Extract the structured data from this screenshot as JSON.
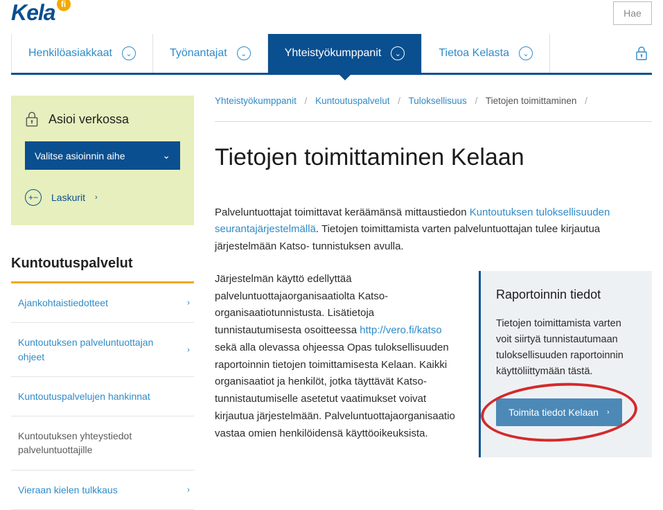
{
  "header": {
    "logo_text": "Kela",
    "logo_badge": "fi",
    "search_placeholder": "Hae"
  },
  "nav": {
    "items": [
      {
        "label": "Henkilöasiakkaat",
        "active": false
      },
      {
        "label": "Työnantajat",
        "active": false
      },
      {
        "label": "Yhteistyökumppanit",
        "active": true
      },
      {
        "label": "Tietoa Kelasta",
        "active": false
      }
    ]
  },
  "asioi": {
    "title": "Asioi verkossa",
    "select_label": "Valitse asioinnin aihe",
    "laskurit_label": "Laskurit"
  },
  "section_title": "Kuntoutuspalvelut",
  "sidebar_items": [
    {
      "label": "Ajankohtaistiedotteet",
      "link": true,
      "chevron": true
    },
    {
      "label": "Kuntoutuksen palveluntuottajan ohjeet",
      "link": true,
      "chevron": true
    },
    {
      "label": "Kuntoutuspalvelujen hankinnat",
      "link": true,
      "chevron": false
    },
    {
      "label": "Kuntoutuksen yhteystiedot palveluntuottajille",
      "link": false,
      "chevron": false
    },
    {
      "label": "Vieraan kielen tulkkaus",
      "link": true,
      "chevron": true
    }
  ],
  "breadcrumb": [
    {
      "label": "Yhteistyökumppanit",
      "link": true
    },
    {
      "label": "Kuntoutuspalvelut",
      "link": true
    },
    {
      "label": "Tuloksellisuus",
      "link": true
    },
    {
      "label": "Tietojen toimittaminen",
      "link": false
    }
  ],
  "page_heading": "Tietojen toimittaminen Kelaan",
  "paragraphs": {
    "p1_a": "Palveluntuottajat toimittavat keräämänsä mittaustiedon ",
    "p1_link": "Kuntoutuksen tuloksellisuuden seurantajärjestelmällä",
    "p1_b": ". Tietojen toimittamista varten palveluntuottajan tulee kirjautua järjestelmään Katso- tunnistuksen avulla.",
    "p2_a": "Järjestelmän käyttö edellyttää palveluntuottajaorganisaatiolta Katso-organisaatiotunnistusta. Lisätietoja tunnistautumisesta osoitteessa ",
    "p2_link_text": "http://vero.fi/katso",
    "p2_b": " sekä alla olevassa ohjeessa Opas tuloksellisuuden raportoinnin tietojen toimittamisesta Kelaan. Kaikki organisaatiot ja henkilöt, jotka täyttävät Katso-tunnistautumiselle asetetut vaatimukset voivat kirjautua järjestelmään. Palveluntuottajaorganisaatio vastaa omien henkilöidensä käyttöoikeuksista."
  },
  "info_card": {
    "title": "Raportoinnin tiedot",
    "body": "Tietojen toimittamista varten voit siirtyä tunnistautumaan tuloksellisuuden raportoinnin käyttöliittymään tästä.",
    "button_label": "Toimita tiedot Kelaan"
  }
}
